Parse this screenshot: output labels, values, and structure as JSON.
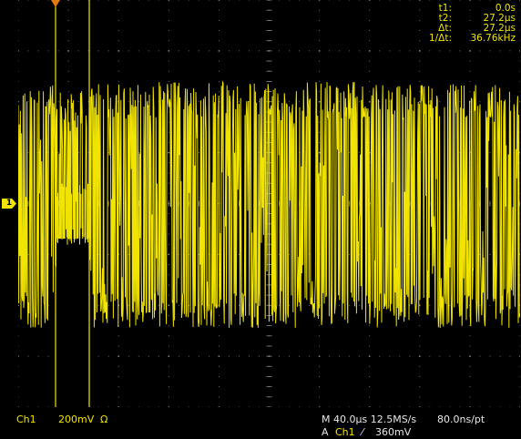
{
  "cursor_readout": {
    "rows": [
      {
        "label": "t1:",
        "value": "0.0s"
      },
      {
        "label": "t2:",
        "value": "27.2µs"
      },
      {
        "label": "Δt:",
        "value": "27.2µs"
      },
      {
        "label": "1/Δt:",
        "value": "36.76kHz"
      }
    ]
  },
  "status_bar": {
    "channel": "Ch1",
    "volts_per_div": "200mV",
    "impedance": "Ω",
    "timebase": "M 40.0µs 12.5MS/s",
    "sample_interval": "80.0ns/pt",
    "trigger_prefix": "A",
    "trigger_channel": "Ch1",
    "trigger_slope": "⁄",
    "trigger_level": "360mV"
  },
  "channel_marker": "1",
  "colors": {
    "trace": "#f0e400",
    "cursor": "#f0e400",
    "trigger_marker": "#e27a10",
    "graticule": "#8a8a8a"
  }
}
